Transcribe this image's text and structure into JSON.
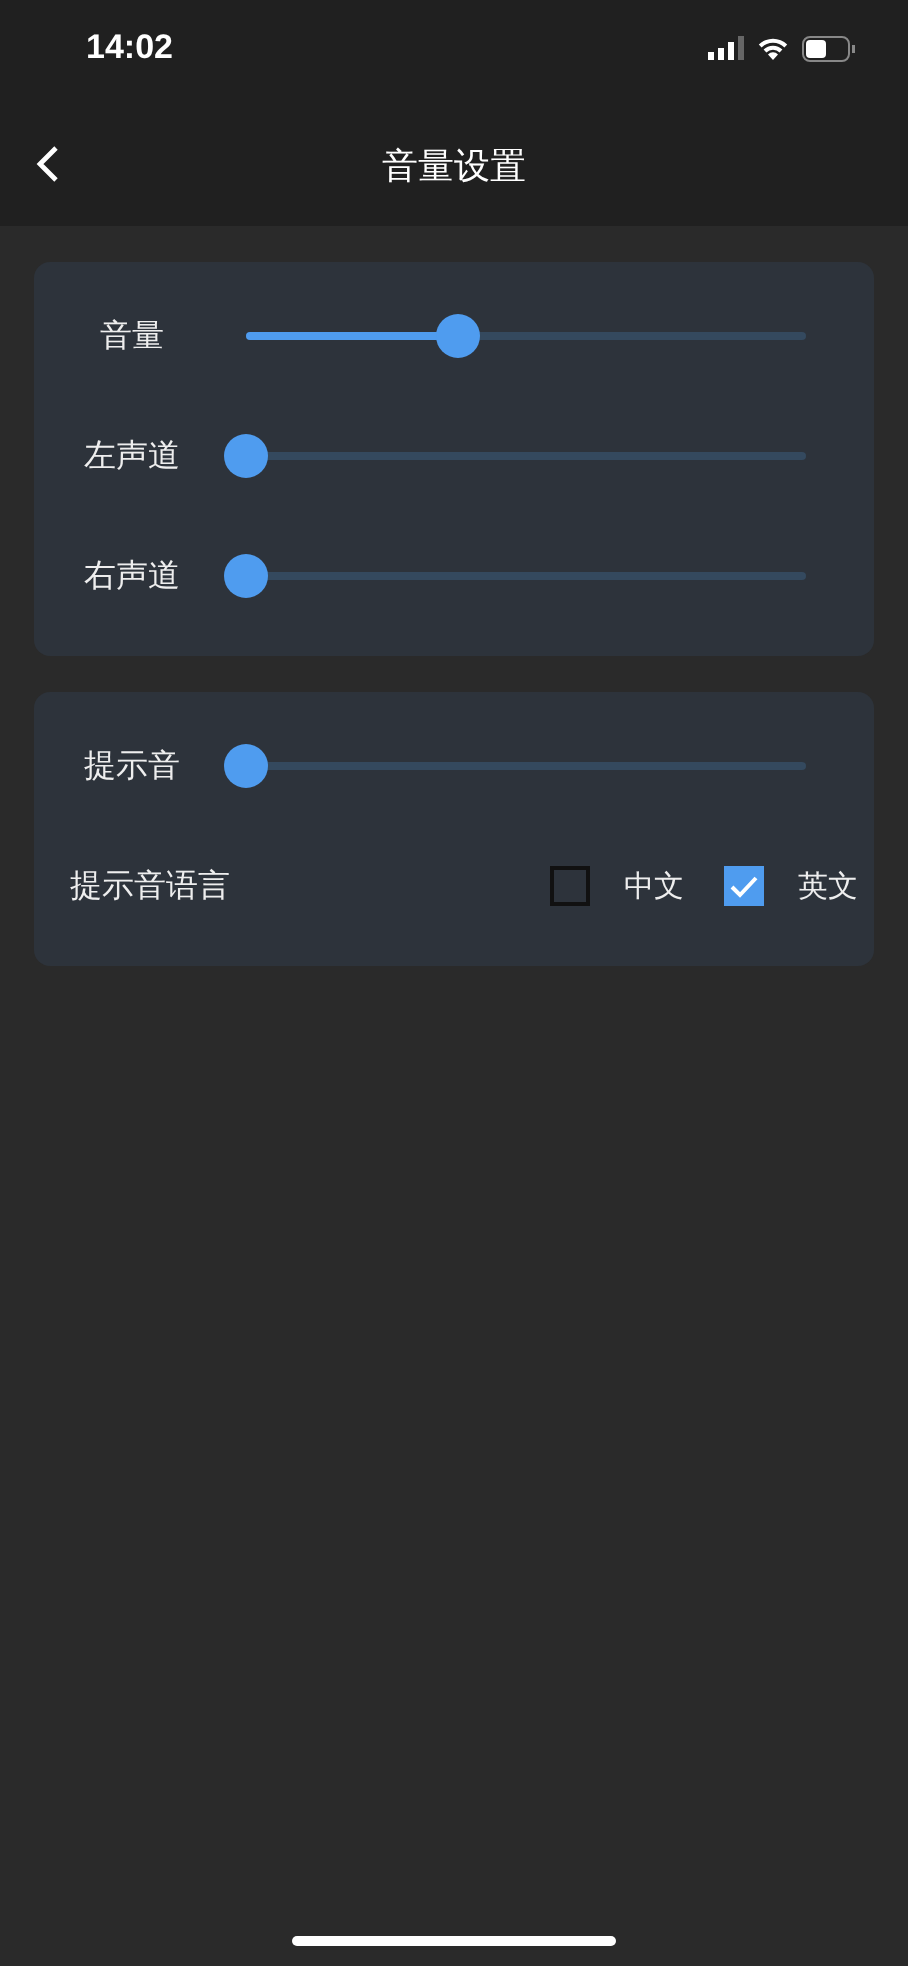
{
  "status_bar": {
    "time": "14:02"
  },
  "header": {
    "title": "音量设置"
  },
  "cards": [
    {
      "sliders": [
        {
          "label": "音量",
          "level": 0.38
        },
        {
          "label": "左声道",
          "level": 0
        },
        {
          "label": "右声道",
          "level": 0
        }
      ]
    },
    {
      "sliders": [
        {
          "label": "提示音",
          "level": 0
        }
      ],
      "language": {
        "label": "提示音语言",
        "options": [
          {
            "label": "中文",
            "checked": false
          },
          {
            "label": "英文",
            "checked": true
          }
        ]
      }
    }
  ]
}
